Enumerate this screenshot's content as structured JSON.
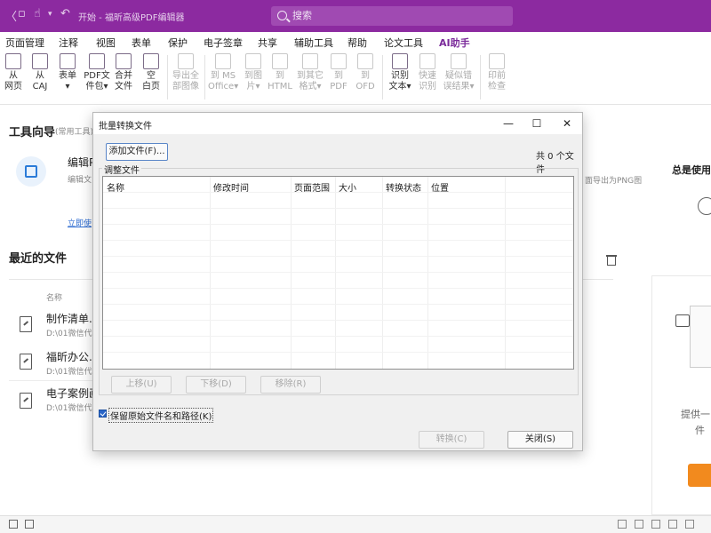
{
  "titlebar": {
    "title": "开始 - 福昕高级PDF编辑器",
    "search_placeholder": "搜索"
  },
  "menu": [
    "页面管理",
    "注释",
    "视图",
    "表单",
    "保护",
    "电子签章",
    "共享",
    "辅助工具",
    "帮助",
    "论文工具",
    "AI助手"
  ],
  "ribbon": {
    "buttons": [
      {
        "l1": "从",
        "l2": "网页"
      },
      {
        "l1": "从",
        "l2": "CAJ"
      },
      {
        "l1": "表单",
        "l2": "▾"
      },
      {
        "l1": "PDF文",
        "l2": "件包▾"
      },
      {
        "l1": "合并",
        "l2": "文件"
      },
      {
        "l1": "空",
        "l2": "白页"
      },
      {
        "l1": "导出全",
        "l2": "部图像"
      },
      {
        "l1": "到 MS",
        "l2": "Office▾"
      },
      {
        "l1": "到图",
        "l2": "片▾"
      },
      {
        "l1": "到",
        "l2": "HTML"
      },
      {
        "l1": "到其它",
        "l2": "格式▾"
      },
      {
        "l1": "到",
        "l2": "PDF"
      },
      {
        "l1": "到",
        "l2": "OFD"
      },
      {
        "l1": "识别",
        "l2": "文本▾"
      },
      {
        "l1": "快速",
        "l2": "识别"
      },
      {
        "l1": "疑似错",
        "l2": "误结果▾"
      },
      {
        "l1": "印前",
        "l2": "检查"
      }
    ]
  },
  "left": {
    "tool_guide": "工具向导",
    "tool_guide_sub": "(常用工具)",
    "edit_title": "编辑P",
    "edit_desc": "编辑文",
    "start_link": "立即使",
    "recent_title": "最近的文件",
    "name_col": "名称",
    "files": [
      {
        "name": "制作清单.pd",
        "path": "D:\\01微信代"
      },
      {
        "name": "福昕办公.pd",
        "path": "D:\\01微信代"
      },
      {
        "name": "电子案例画",
        "path": "D:\\01微信代"
      }
    ],
    "right_hint": "面导出为PNG图",
    "right_title": "总是使用",
    "right_bottom1": "提供一",
    "right_bottom2": "件"
  },
  "dialog": {
    "title": "批量转换文件",
    "add_file": "添加文件(F)...",
    "file_count": "共 0 个文件",
    "group_label": "调整文件",
    "columns": [
      "名称",
      "修改时间",
      "页面范围",
      "大小",
      "转换状态",
      "位置"
    ],
    "move_up": "上移(U)",
    "move_down": "下移(D)",
    "remove": "移除(R)",
    "keep_name": "保留原始文件名和路径(K)",
    "convert": "转换(C)",
    "close": "关闭(S)"
  }
}
